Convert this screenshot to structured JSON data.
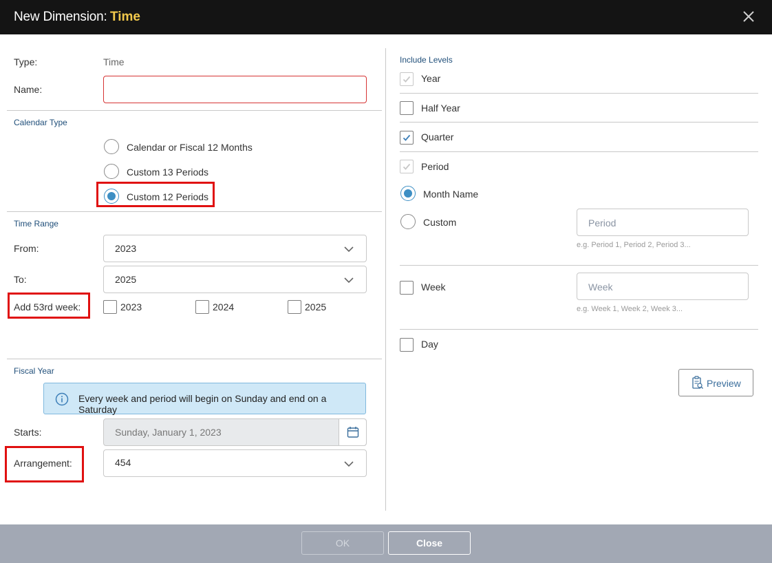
{
  "dialog": {
    "title_prefix": "New Dimension:",
    "title_name": "Time",
    "ok_label": "OK",
    "close_label": "Close"
  },
  "left": {
    "type_label": "Type:",
    "type_value": "Time",
    "name_label": "Name:",
    "name_value": "",
    "calendar_section": "Calendar Type",
    "calendar_options": [
      {
        "label": "Calendar or Fiscal 12 Months",
        "selected": false
      },
      {
        "label": "Custom 13 Periods",
        "selected": false
      },
      {
        "label": "Custom 12 Periods",
        "selected": true
      }
    ],
    "time_range_section": "Time Range",
    "from_label": "From:",
    "from_value": "2023",
    "to_label": "To:",
    "to_value": "2025",
    "add53_label": "Add 53rd week:",
    "add53_years": [
      "2023",
      "2024",
      "2025"
    ],
    "fiscal_section": "Fiscal Year",
    "info_text": "Every week and period will begin on Sunday and end on a Saturday",
    "starts_label": "Starts:",
    "starts_value": "Sunday, January 1, 2023",
    "arrangement_label": "Arrangement:",
    "arrangement_value": "454"
  },
  "right": {
    "include_section": "Include Levels",
    "year_label": "Year",
    "half_year_label": "Half Year",
    "quarter_label": "Quarter",
    "period_label": "Period",
    "month_name_label": "Month Name",
    "custom_label": "Custom",
    "period_placeholder": "Period",
    "period_hint": "e.g. Period 1, Period 2, Period 3...",
    "week_label": "Week",
    "week_placeholder": "Week",
    "week_hint": "e.g. Week 1, Week 2, Week 3...",
    "day_label": "Day",
    "preview_label": "Preview"
  },
  "colors": {
    "title_accent": "#f2c94c",
    "highlight": "#e01010",
    "radio_on": "#3d8fc4"
  }
}
